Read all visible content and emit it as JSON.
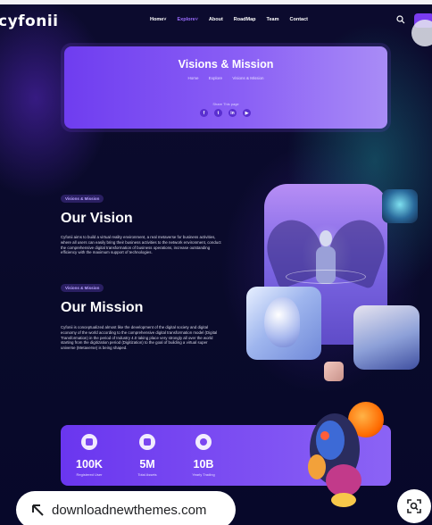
{
  "header": {
    "logo": "cyfonii",
    "nav": [
      {
        "label": "Home",
        "has_dropdown": true,
        "active": false
      },
      {
        "label": "Explore",
        "has_dropdown": true,
        "active": true
      },
      {
        "label": "About",
        "has_dropdown": false,
        "active": false
      },
      {
        "label": "RoadMap",
        "has_dropdown": false,
        "active": false
      },
      {
        "label": "Team",
        "has_dropdown": false,
        "active": false
      },
      {
        "label": "Contact",
        "has_dropdown": false,
        "active": false
      }
    ],
    "icons": {
      "search": "search-icon",
      "cta": "menu-button"
    }
  },
  "hero": {
    "title": "Visions & Mission",
    "breadcrumb": [
      "Home",
      "Explore",
      "Visions & Mission"
    ],
    "share_label": "Share This page",
    "socials": [
      "facebook-icon",
      "twitter-icon",
      "linkedin-icon",
      "youtube-icon"
    ]
  },
  "vision": {
    "badge": "Visions & Mission",
    "heading": "Our Vision",
    "text": "Cyfonii aims to build a virtual reality environment, a real metaverse for business activities, where all users can easily bring their business activities to the network environment, conduct the comprehensive digital transformation of business operations, increase outstanding efficiency with the maximum support of technologies."
  },
  "mission": {
    "badge": "Visions & Mission",
    "heading": "Our Mission",
    "text": "Cyfonii is conceptualized almost like the development of the digital society and digital economy of the world according to the comprehensive digital transformation model (Digital Transformation) in the period of Industry 4.0 taking place very strongly all over the world starting from the digitization period (Digitization) to the goal of building a virtual super universe (Metaverse) is being shaped."
  },
  "stats": [
    {
      "value": "100K",
      "label": "Registered User",
      "icon": "users-icon"
    },
    {
      "value": "5M",
      "label": "Total Assets",
      "icon": "assets-icon"
    },
    {
      "value": "10B",
      "label": "Yearly Trading",
      "icon": "pie-chart-icon"
    }
  ],
  "overlay": {
    "visit_url": "downloadnewthemes.com",
    "lens_icon": "lens-icon",
    "zoom_icon": "zoom-search-icon"
  },
  "colors": {
    "accent": "#7a3cf0",
    "background": "#08092a",
    "active_nav": "#9b6cff"
  }
}
